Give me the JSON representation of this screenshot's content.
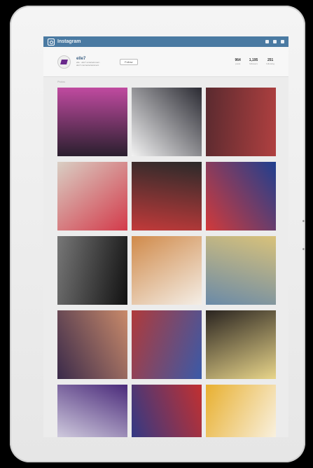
{
  "app": {
    "title": "Instagram"
  },
  "profile": {
    "username": "elle7",
    "bio": "elle · abc7 entertainment · abc7.com/entertainment",
    "follow_label": "Follow",
    "stats": [
      {
        "value": "964",
        "label": "posts"
      },
      {
        "value": "1,195",
        "label": "followers"
      },
      {
        "value": "251",
        "label": "following"
      }
    ]
  },
  "subbar": {
    "left": "Photos"
  },
  "tiles": [
    {
      "name": "tile-crowd-concert",
      "c1": "#2a1f2e",
      "c2": "#c04aa0"
    },
    {
      "name": "tile-three-men",
      "c1": "#f2f2f2",
      "c2": "#2b2b33"
    },
    {
      "name": "tile-party-crowd",
      "c1": "#5a2a2f",
      "c2": "#b04040"
    },
    {
      "name": "tile-couple-sign",
      "c1": "#d9cfc4",
      "c2": "#d33a4a"
    },
    {
      "name": "tile-group-sunday",
      "c1": "#2a2a2a",
      "c2": "#c23a3a"
    },
    {
      "name": "tile-mousetrap-poster",
      "c1": "#1f3f8f",
      "c2": "#d23a3a"
    },
    {
      "name": "tile-bw-portrait",
      "c1": "#111",
      "c2": "#777"
    },
    {
      "name": "tile-lasagna",
      "c1": "#f4eee6",
      "c2": "#d08a4a"
    },
    {
      "name": "tile-street-scene",
      "c1": "#6a8aa8",
      "c2": "#d9c27a"
    },
    {
      "name": "tile-stage-group",
      "c1": "#3a2a4a",
      "c2": "#c98a6a"
    },
    {
      "name": "tile-event-collage",
      "c1": "#b03a3a",
      "c2": "#3a5aa8"
    },
    {
      "name": "tile-food-tray",
      "c1": "#2a2420",
      "c2": "#e8d58a"
    },
    {
      "name": "tile-purple-stage",
      "c1": "#4a2a7a",
      "c2": "#e8e8f0"
    },
    {
      "name": "tile-red-shirts",
      "c1": "#c23030",
      "c2": "#2a3a8a"
    },
    {
      "name": "tile-dessert-plate",
      "c1": "#faf6ee",
      "c2": "#e8b030"
    }
  ]
}
